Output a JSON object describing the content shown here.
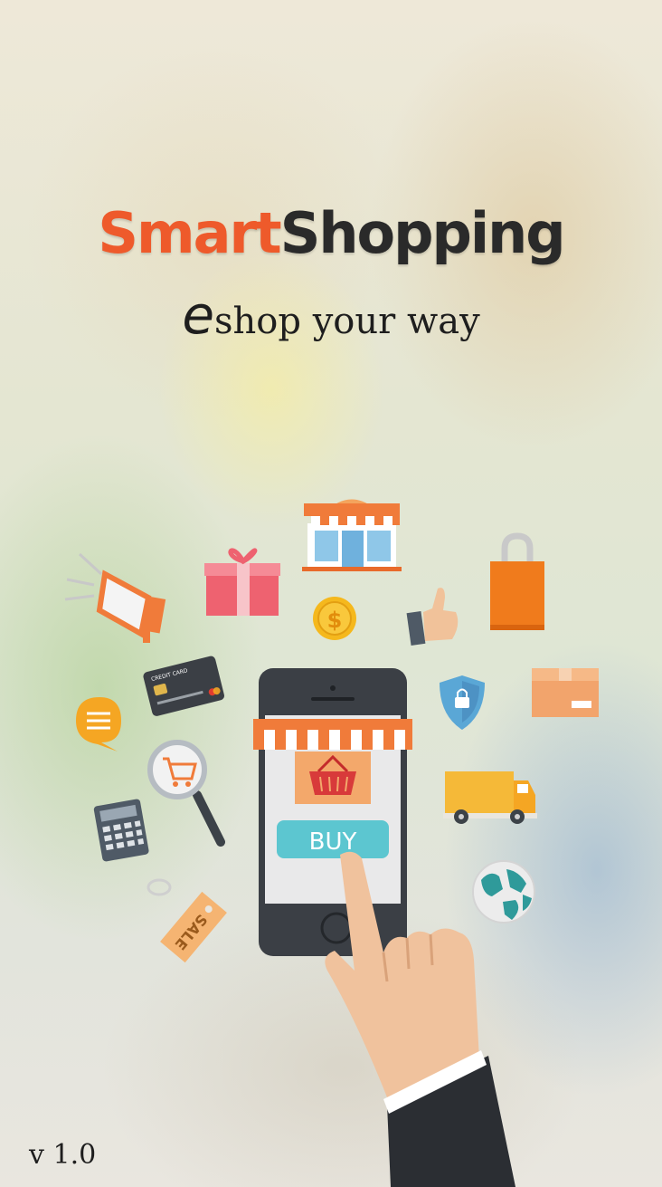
{
  "brand": {
    "part1": "Smart",
    "part2": "Shopping"
  },
  "tagline": {
    "e": "e",
    "text": "shop your way"
  },
  "illustration": {
    "buy_button": "BUY",
    "credit_card_label": "CREDIT CARD",
    "sale_tag": "SALE",
    "coin_symbol": "$"
  },
  "version": {
    "prefix": "v",
    "number": "1.0"
  },
  "colors": {
    "brand_orange": "#ee5a2b",
    "brand_dark": "#2a2a2a",
    "buy_button": "#5cc6d0"
  }
}
